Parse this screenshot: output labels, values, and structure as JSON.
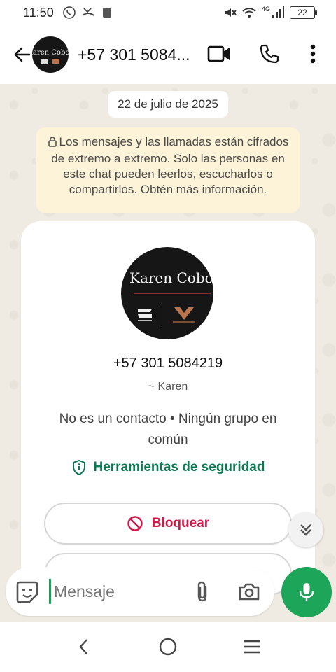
{
  "status_bar": {
    "time": "11:50",
    "network": "4G",
    "battery": "22"
  },
  "header": {
    "contact_title": "+57 301 5084...",
    "avatar_text": "Karen Cobos"
  },
  "chat": {
    "date": "22 de julio de 2025",
    "encryption_notice": "Los mensajes y las llamadas están cifrados de extremo a extremo. Solo las personas en este chat pueden leerlos, escucharlos o compartirlos. Obtén más información."
  },
  "profile": {
    "avatar_name": "Karen Cobos",
    "phone": "+57 301 5084219",
    "alias": "~ Karen",
    "relation": "No es un contacto • Ningún grupo en común",
    "security_tools": "Herramientas de seguridad",
    "block_label": "Bloquear"
  },
  "composer": {
    "placeholder": "Mensaje"
  },
  "colors": {
    "accent_green": "#1da65a",
    "security_green": "#0b7a50",
    "block_red": "#cf1a4a",
    "encryption_bg": "#fdf3d8"
  }
}
